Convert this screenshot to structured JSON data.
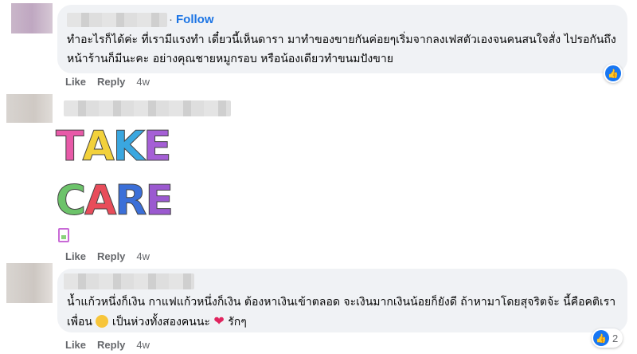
{
  "comments": [
    {
      "follow_label": "Follow",
      "follow_sep": "·",
      "text": "ทำอะไรก็ได้ค่ะ ที่เรามีแรงทำ เดี๋ยวนี้เห็นดารา มาทำของขายกันค่อยๆเริ่มจากลงเฟสตัวเองจนคนสนใจสั่ง ไปรอกันถึงหน้าร้านก็มีนะคะ อย่างคุณชายหมูกรอบ หรือน้องเดียวทำขนมปังขาย",
      "like_label": "Like",
      "reply_label": "Reply",
      "time": "4w"
    },
    {
      "sticker_line1": [
        "T",
        "A",
        "K",
        "E"
      ],
      "sticker_line2": [
        "C",
        "A",
        "R",
        "E"
      ],
      "like_label": "Like",
      "reply_label": "Reply",
      "time": "4w"
    },
    {
      "text_part1": "น้ำแก้วหนึ่งก็เงิน กาแฟแก้วหนึ่งก็เงิน ต้องหาเงินเข้าตลอด จะเงินมากเงินน้อยก็ยังดี ถ้าหามาโดยสุจริต",
      "text_part2": "จ้ะ นี้คือคติเราเพื่อน",
      "text_part3": " เป็นห่วงทั้งสองคนนะ ",
      "text_part4": " รักๆ",
      "like_label": "Like",
      "reply_label": "Reply",
      "time": "4w",
      "reaction_count": "2"
    }
  ],
  "colors": {
    "bubble_bg": "#f0f2f5",
    "link_blue": "#1b74e4",
    "meta_gray": "#65676b",
    "like_blue": "#1877f2"
  },
  "icons": [
    "like-reaction-icon",
    "smile-emoji-icon",
    "heart-emoji-icon",
    "sticker-file-icon"
  ]
}
